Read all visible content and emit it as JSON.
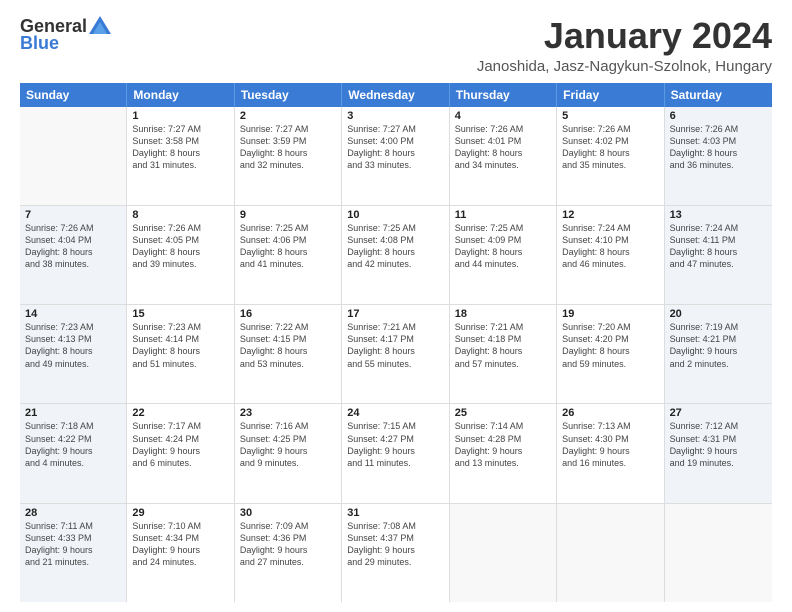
{
  "logo": {
    "general": "General",
    "blue": "Blue"
  },
  "title": "January 2024",
  "location": "Janoshida, Jasz-Nagykun-Szolnok, Hungary",
  "days": [
    "Sunday",
    "Monday",
    "Tuesday",
    "Wednesday",
    "Thursday",
    "Friday",
    "Saturday"
  ],
  "weeks": [
    [
      {
        "day": "",
        "lines": []
      },
      {
        "day": "1",
        "lines": [
          "Sunrise: 7:27 AM",
          "Sunset: 3:58 PM",
          "Daylight: 8 hours",
          "and 31 minutes."
        ]
      },
      {
        "day": "2",
        "lines": [
          "Sunrise: 7:27 AM",
          "Sunset: 3:59 PM",
          "Daylight: 8 hours",
          "and 32 minutes."
        ]
      },
      {
        "day": "3",
        "lines": [
          "Sunrise: 7:27 AM",
          "Sunset: 4:00 PM",
          "Daylight: 8 hours",
          "and 33 minutes."
        ]
      },
      {
        "day": "4",
        "lines": [
          "Sunrise: 7:26 AM",
          "Sunset: 4:01 PM",
          "Daylight: 8 hours",
          "and 34 minutes."
        ]
      },
      {
        "day": "5",
        "lines": [
          "Sunrise: 7:26 AM",
          "Sunset: 4:02 PM",
          "Daylight: 8 hours",
          "and 35 minutes."
        ]
      },
      {
        "day": "6",
        "lines": [
          "Sunrise: 7:26 AM",
          "Sunset: 4:03 PM",
          "Daylight: 8 hours",
          "and 36 minutes."
        ]
      }
    ],
    [
      {
        "day": "7",
        "lines": [
          "Sunrise: 7:26 AM",
          "Sunset: 4:04 PM",
          "Daylight: 8 hours",
          "and 38 minutes."
        ]
      },
      {
        "day": "8",
        "lines": [
          "Sunrise: 7:26 AM",
          "Sunset: 4:05 PM",
          "Daylight: 8 hours",
          "and 39 minutes."
        ]
      },
      {
        "day": "9",
        "lines": [
          "Sunrise: 7:25 AM",
          "Sunset: 4:06 PM",
          "Daylight: 8 hours",
          "and 41 minutes."
        ]
      },
      {
        "day": "10",
        "lines": [
          "Sunrise: 7:25 AM",
          "Sunset: 4:08 PM",
          "Daylight: 8 hours",
          "and 42 minutes."
        ]
      },
      {
        "day": "11",
        "lines": [
          "Sunrise: 7:25 AM",
          "Sunset: 4:09 PM",
          "Daylight: 8 hours",
          "and 44 minutes."
        ]
      },
      {
        "day": "12",
        "lines": [
          "Sunrise: 7:24 AM",
          "Sunset: 4:10 PM",
          "Daylight: 8 hours",
          "and 46 minutes."
        ]
      },
      {
        "day": "13",
        "lines": [
          "Sunrise: 7:24 AM",
          "Sunset: 4:11 PM",
          "Daylight: 8 hours",
          "and 47 minutes."
        ]
      }
    ],
    [
      {
        "day": "14",
        "lines": [
          "Sunrise: 7:23 AM",
          "Sunset: 4:13 PM",
          "Daylight: 8 hours",
          "and 49 minutes."
        ]
      },
      {
        "day": "15",
        "lines": [
          "Sunrise: 7:23 AM",
          "Sunset: 4:14 PM",
          "Daylight: 8 hours",
          "and 51 minutes."
        ]
      },
      {
        "day": "16",
        "lines": [
          "Sunrise: 7:22 AM",
          "Sunset: 4:15 PM",
          "Daylight: 8 hours",
          "and 53 minutes."
        ]
      },
      {
        "day": "17",
        "lines": [
          "Sunrise: 7:21 AM",
          "Sunset: 4:17 PM",
          "Daylight: 8 hours",
          "and 55 minutes."
        ]
      },
      {
        "day": "18",
        "lines": [
          "Sunrise: 7:21 AM",
          "Sunset: 4:18 PM",
          "Daylight: 8 hours",
          "and 57 minutes."
        ]
      },
      {
        "day": "19",
        "lines": [
          "Sunrise: 7:20 AM",
          "Sunset: 4:20 PM",
          "Daylight: 8 hours",
          "and 59 minutes."
        ]
      },
      {
        "day": "20",
        "lines": [
          "Sunrise: 7:19 AM",
          "Sunset: 4:21 PM",
          "Daylight: 9 hours",
          "and 2 minutes."
        ]
      }
    ],
    [
      {
        "day": "21",
        "lines": [
          "Sunrise: 7:18 AM",
          "Sunset: 4:22 PM",
          "Daylight: 9 hours",
          "and 4 minutes."
        ]
      },
      {
        "day": "22",
        "lines": [
          "Sunrise: 7:17 AM",
          "Sunset: 4:24 PM",
          "Daylight: 9 hours",
          "and 6 minutes."
        ]
      },
      {
        "day": "23",
        "lines": [
          "Sunrise: 7:16 AM",
          "Sunset: 4:25 PM",
          "Daylight: 9 hours",
          "and 9 minutes."
        ]
      },
      {
        "day": "24",
        "lines": [
          "Sunrise: 7:15 AM",
          "Sunset: 4:27 PM",
          "Daylight: 9 hours",
          "and 11 minutes."
        ]
      },
      {
        "day": "25",
        "lines": [
          "Sunrise: 7:14 AM",
          "Sunset: 4:28 PM",
          "Daylight: 9 hours",
          "and 13 minutes."
        ]
      },
      {
        "day": "26",
        "lines": [
          "Sunrise: 7:13 AM",
          "Sunset: 4:30 PM",
          "Daylight: 9 hours",
          "and 16 minutes."
        ]
      },
      {
        "day": "27",
        "lines": [
          "Sunrise: 7:12 AM",
          "Sunset: 4:31 PM",
          "Daylight: 9 hours",
          "and 19 minutes."
        ]
      }
    ],
    [
      {
        "day": "28",
        "lines": [
          "Sunrise: 7:11 AM",
          "Sunset: 4:33 PM",
          "Daylight: 9 hours",
          "and 21 minutes."
        ]
      },
      {
        "day": "29",
        "lines": [
          "Sunrise: 7:10 AM",
          "Sunset: 4:34 PM",
          "Daylight: 9 hours",
          "and 24 minutes."
        ]
      },
      {
        "day": "30",
        "lines": [
          "Sunrise: 7:09 AM",
          "Sunset: 4:36 PM",
          "Daylight: 9 hours",
          "and 27 minutes."
        ]
      },
      {
        "day": "31",
        "lines": [
          "Sunrise: 7:08 AM",
          "Sunset: 4:37 PM",
          "Daylight: 9 hours",
          "and 29 minutes."
        ]
      },
      {
        "day": "",
        "lines": []
      },
      {
        "day": "",
        "lines": []
      },
      {
        "day": "",
        "lines": []
      }
    ]
  ]
}
